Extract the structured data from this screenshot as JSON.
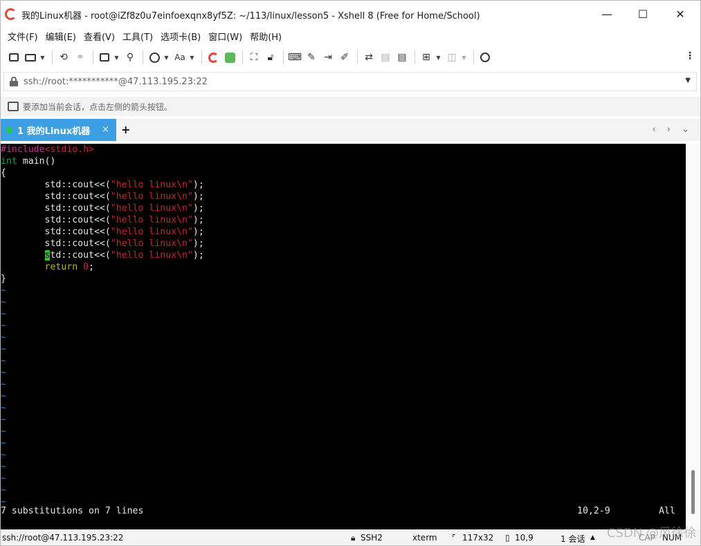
{
  "window": {
    "title": "我的Linux机器 - root@iZf8z0u7einfoexqnx8yf5Z: ~/113/linux/lesson5 - Xshell 8 (Free for Home/School)",
    "minimize": "—",
    "maximize": "☐",
    "close": "✕"
  },
  "menu": [
    "文件(F)",
    "编辑(E)",
    "查看(V)",
    "工具(T)",
    "选项卡(B)",
    "窗口(W)",
    "帮助(H)"
  ],
  "toolbar": {
    "font_label": "Aa",
    "more": "⋮"
  },
  "address": {
    "value": "ssh://root:***********@47.113.195.23:22",
    "dropdown": "▼"
  },
  "hint": {
    "text": "要添加当前会话，点击左侧的箭头按钮。"
  },
  "tab": {
    "label": "1 我的Linux机器",
    "close": "×",
    "add": "+",
    "nav": "‹ › ⌄"
  },
  "terminal": {
    "colors": {
      "preproc": "#c0329c",
      "include_file": "#d21f3b",
      "type": "#1aa344",
      "string": "#cf2034",
      "number": "#cf2034",
      "keyword": "#c7b21a",
      "cursor": "#22cc22",
      "tilde": "#2a7fd4"
    },
    "include_directive": "#include",
    "include_file": "<stdio.h>",
    "main_type": "int",
    "main_rest": " main()",
    "open_brace": "{",
    "cout_indent": "        ",
    "cout_prefix": "std::cout<<(",
    "cout_string": "\"hello linux\\n\"",
    "cout_suffix": ");",
    "cursor_char": "s",
    "cursor_rest": "td::cout<<(",
    "return_keyword": "return",
    "return_value": "0",
    "return_end": ";",
    "close_brace": "}",
    "tilde": "~",
    "message": "7 substitutions on 7 lines",
    "position": "10,2-9",
    "scroll_pos": "All"
  },
  "status": {
    "connection": "ssh://root@47.113.195.23:22",
    "protocol": "SSH2",
    "terminal_type": "xterm",
    "size": "117x32",
    "cursor": "10,9",
    "sessions": "1 会话",
    "caps": "CAP",
    "num": "NUM"
  },
  "watermark": "CSDN @风徐徐"
}
